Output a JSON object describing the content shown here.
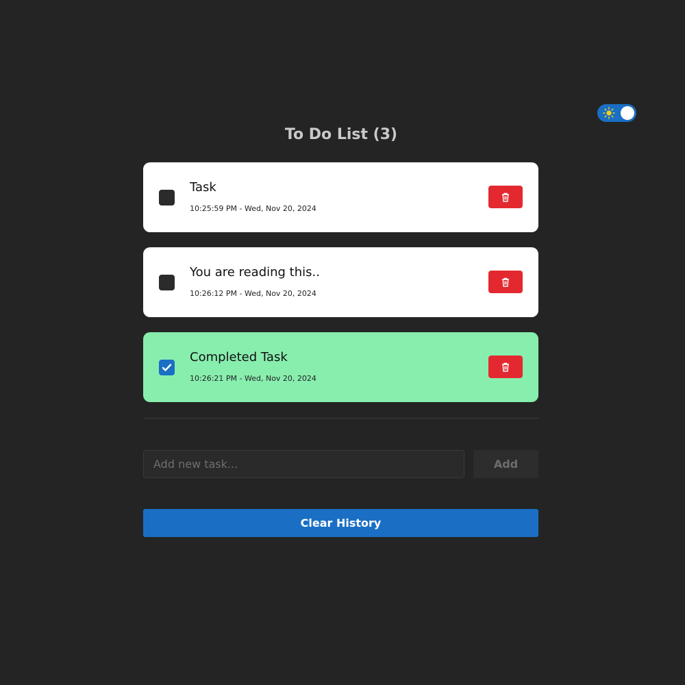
{
  "theme": {
    "toggle_icon": "sun-icon",
    "mode": "dark",
    "toggle_on": true
  },
  "header": {
    "title": "To Do List (3)"
  },
  "tasks": [
    {
      "name": "Task",
      "timestamp": "10:25:59 PM - Wed, Nov 20, 2024",
      "completed": false
    },
    {
      "name": "You are reading this..",
      "timestamp": "10:26:12 PM - Wed, Nov 20, 2024",
      "completed": false
    },
    {
      "name": "Completed Task",
      "timestamp": "10:26:21 PM - Wed, Nov 20, 2024",
      "completed": true
    }
  ],
  "task_icons": {
    "delete": "trash-icon",
    "check": "checkmark-icon"
  },
  "new_task": {
    "placeholder": "Add new task...",
    "value": "",
    "add_label": "Add"
  },
  "footer": {
    "clear_label": "Clear History"
  },
  "colors": {
    "background": "#242424",
    "accent": "#1a6fc4",
    "completed": "#88eeae",
    "delete": "#e3292f",
    "card": "#ffffff"
  }
}
